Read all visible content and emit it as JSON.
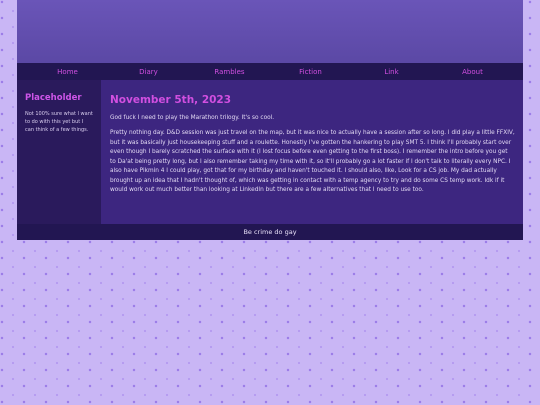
{
  "nav": {
    "items": [
      {
        "label": "Home"
      },
      {
        "label": "Diary"
      },
      {
        "label": "Rambles"
      },
      {
        "label": "Fiction"
      },
      {
        "label": "Link"
      },
      {
        "label": "About"
      }
    ]
  },
  "sidebar": {
    "title": "Placeholder",
    "text": "Not 100% sure what I want to do with this yet but I can think of a few things."
  },
  "post": {
    "date": "November 5th, 2023",
    "paragraphs": [
      "God fuck I need to play the Marathon trilogy. It's so cool.",
      "Pretty nothing day. D&D session was just travel on the map, but it was nice to actually have a session after so long. I did play a little FFXIV, but it was basically just housekeeping stuff and a roulette. Honestly I've gotten the hankering to play SMT 5. I think I'll probably start over even though I barely scratched the surface with it (I lost focus before even getting to the first boss). I remember the intro before you get to Da'at being pretty long, but I also remember taking my time with it, so it'll probably go a lot faster if I don't talk to literally every NPC. I also have Pikmin 4 I could play, got that for my birthday and haven't touched it. I should also, like, Look for a CS job. My dad actually brought up an idea that I hadn't thought of, which was getting in contact with a temp agency to try and do some CS temp work. Idk if it would work out much better than looking at LinkedIn but there are a few alternatives that I need to use too."
    ]
  },
  "footer": {
    "text": "Be crime do gay"
  },
  "colors": {
    "background": "#c9b6f5",
    "banner": "#5b48a5",
    "nav_bg": "#221652",
    "accent": "#d14fe0",
    "main_bg": "#3d2680",
    "sidebar_bg": "#2a1a5c"
  }
}
